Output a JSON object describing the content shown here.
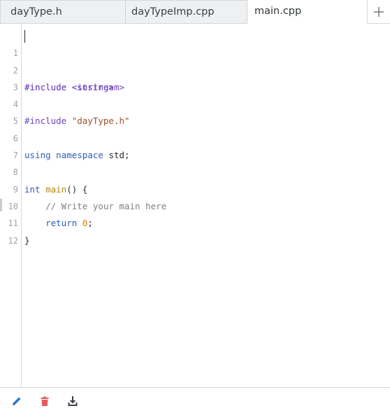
{
  "tabs": [
    {
      "label": "dayType.h",
      "active": false
    },
    {
      "label": "dayTypeImp.cpp",
      "active": false
    },
    {
      "label": "main.cpp",
      "active": true
    }
  ],
  "add_tab_icon": "plus-icon",
  "editor": {
    "line_numbers": [
      "1",
      "2",
      "3",
      "4",
      "5",
      "6",
      "7",
      "8",
      "9",
      "10",
      "11",
      "12"
    ],
    "lines": {
      "l1": {
        "pre": "#include",
        "arg": "<iostream>"
      },
      "l2": {
        "pre": "#include",
        "arg": "<string>"
      },
      "l3": "",
      "l4": {
        "pre": "#include",
        "arg": "\"dayType.h\""
      },
      "l5": "",
      "l6": {
        "kw1": "using",
        "kw2": "namespace",
        "rest": "std;"
      },
      "l7": "",
      "l8": {
        "type": "int",
        "fn": "main",
        "rest": "() {"
      },
      "l9": {
        "comment": "// Write your main here"
      },
      "l10": {
        "kw": "return",
        "num": "0",
        "end": ";"
      },
      "l11": {
        "brace": "}"
      },
      "l12": ""
    }
  },
  "toolbar": {
    "edit_icon": "pencil-icon",
    "delete_icon": "trash-icon",
    "download_icon": "download-icon"
  },
  "colors": {
    "pencil": "#2b78c5",
    "trash": "#e35d5b",
    "download": "#3a3f44"
  }
}
